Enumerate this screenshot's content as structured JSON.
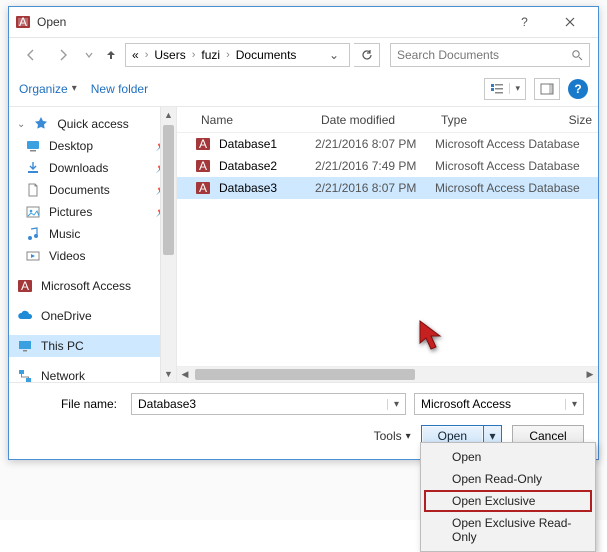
{
  "window": {
    "title": "Open"
  },
  "breadcrumb": {
    "prefix": "«",
    "parts": [
      "Users",
      "fuzi",
      "Documents"
    ]
  },
  "search": {
    "placeholder": "Search Documents"
  },
  "toolbar": {
    "organize": "Organize",
    "newfolder": "New folder"
  },
  "sidebar": {
    "quick": "Quick access",
    "items": [
      "Desktop",
      "Downloads",
      "Documents",
      "Pictures",
      "Music",
      "Videos"
    ],
    "access": "Microsoft Access",
    "onedrive": "OneDrive",
    "thispc": "This PC",
    "network": "Network"
  },
  "columns": {
    "name": "Name",
    "date": "Date modified",
    "type": "Type",
    "size": "Size"
  },
  "rows": [
    {
      "name": "Database1",
      "date": "2/21/2016 8:07 PM",
      "type": "Microsoft Access Database"
    },
    {
      "name": "Database2",
      "date": "2/21/2016 7:49 PM",
      "type": "Microsoft Access Database"
    },
    {
      "name": "Database3",
      "date": "2/21/2016 8:07 PM",
      "type": "Microsoft Access Database"
    }
  ],
  "bottom": {
    "filename_label": "File name:",
    "filename_value": "Database3",
    "filter": "Microsoft Access",
    "tools": "Tools",
    "open": "Open",
    "cancel": "Cancel"
  },
  "menu": {
    "items": [
      "Open",
      "Open Read-Only",
      "Open Exclusive",
      "Open Exclusive Read-Only"
    ],
    "highlight_index": 2
  }
}
